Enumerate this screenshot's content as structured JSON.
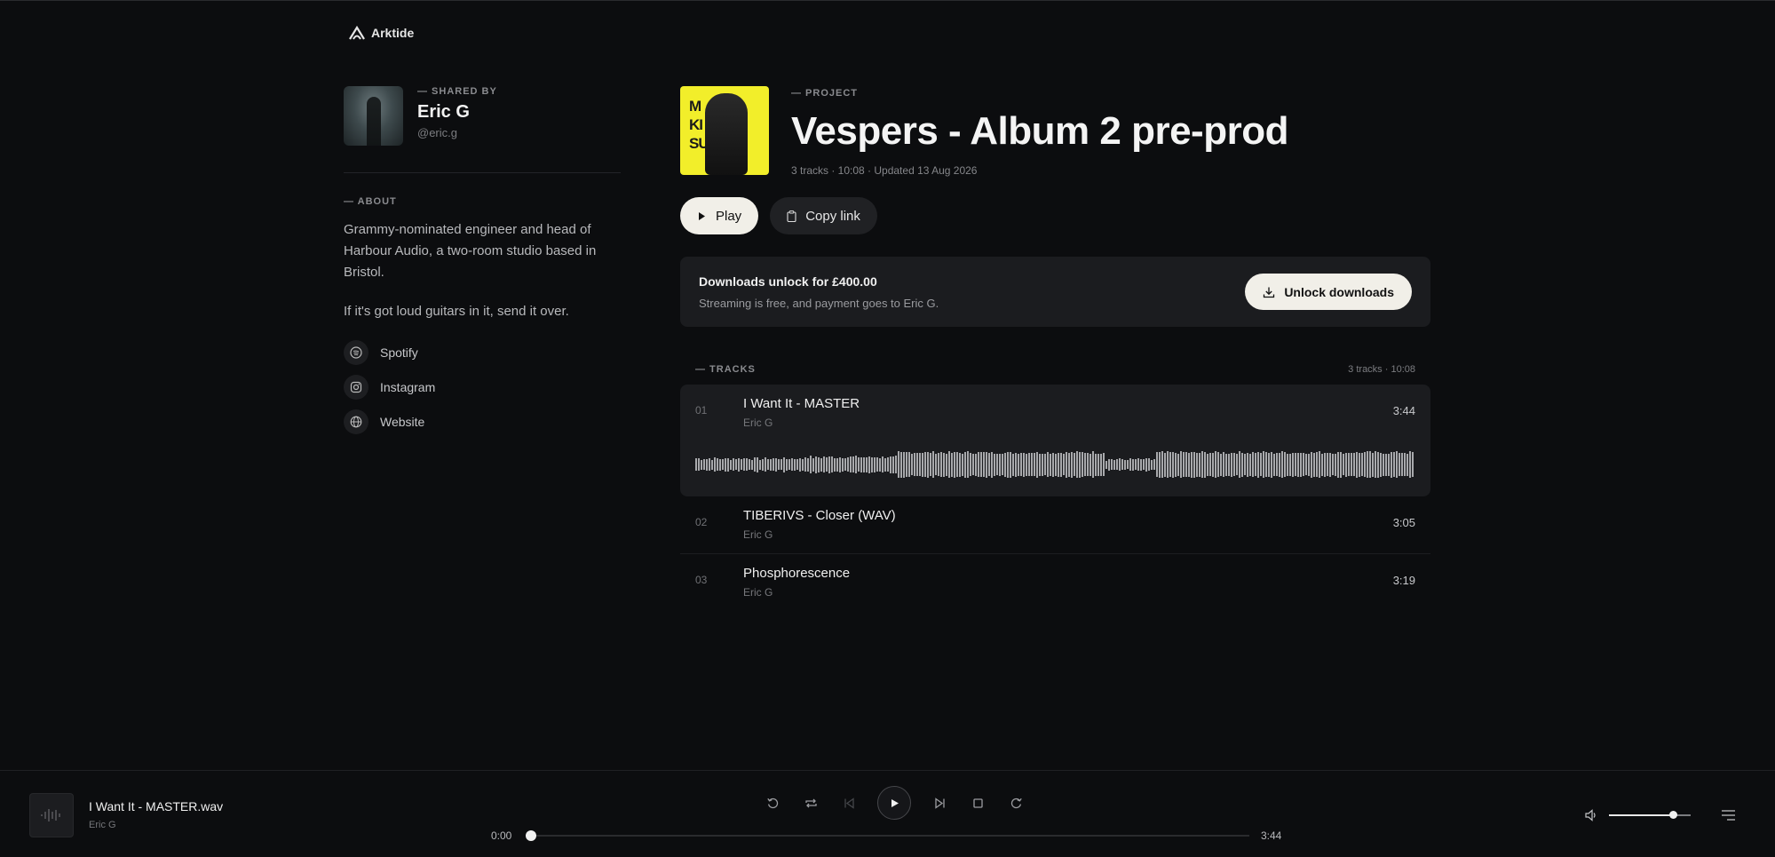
{
  "brand": {
    "name": "Arktide"
  },
  "sharer": {
    "kicker": "— SHARED BY",
    "name": "Eric G",
    "handle": "@eric.g"
  },
  "about": {
    "kicker": "— ABOUT",
    "paragraph1": "Grammy-nominated engineer and head of Harbour Audio, a two-room studio based in Bristol.",
    "paragraph2": "If it's got loud guitars in it, send it over.",
    "links": [
      {
        "label": "Spotify",
        "icon": "spotify-icon"
      },
      {
        "label": "Instagram",
        "icon": "instagram-icon"
      },
      {
        "label": "Website",
        "icon": "globe-icon"
      }
    ]
  },
  "project": {
    "kicker": "— PROJECT",
    "title": "Vespers - Album 2 pre-prod",
    "meta": "3 tracks · 10:08 · Updated 13 Aug 2026",
    "cover_text": "MOULD\nKILLED\nSUCKED.",
    "play_label": "Play",
    "copy_label": "Copy link"
  },
  "unlock": {
    "title": "Downloads unlock for £400.00",
    "subtitle": "Streaming is free, and payment goes to Eric G.",
    "button_label": "Unlock downloads"
  },
  "tracks": {
    "kicker": "— TRACKS",
    "summary": "3 tracks · 10:08",
    "items": [
      {
        "num": "01",
        "title": "I Want It - MASTER",
        "artist": "Eric G",
        "duration": "3:44",
        "active": true
      },
      {
        "num": "02",
        "title": "TIBERIVS - Closer (WAV)",
        "artist": "Eric G",
        "duration": "3:05",
        "active": false
      },
      {
        "num": "03",
        "title": "Phosphorescence",
        "artist": "Eric G",
        "duration": "3:19",
        "active": false
      }
    ]
  },
  "player": {
    "title": "I Want It - MASTER.wav",
    "artist": "Eric G",
    "current_time": "0:00",
    "total_time": "3:44",
    "progress": 0,
    "volume": 0.78
  },
  "colors": {
    "background": "#0c0d0f",
    "accent_button": "#f1efe8",
    "cover_yellow": "#f2ee2a"
  }
}
